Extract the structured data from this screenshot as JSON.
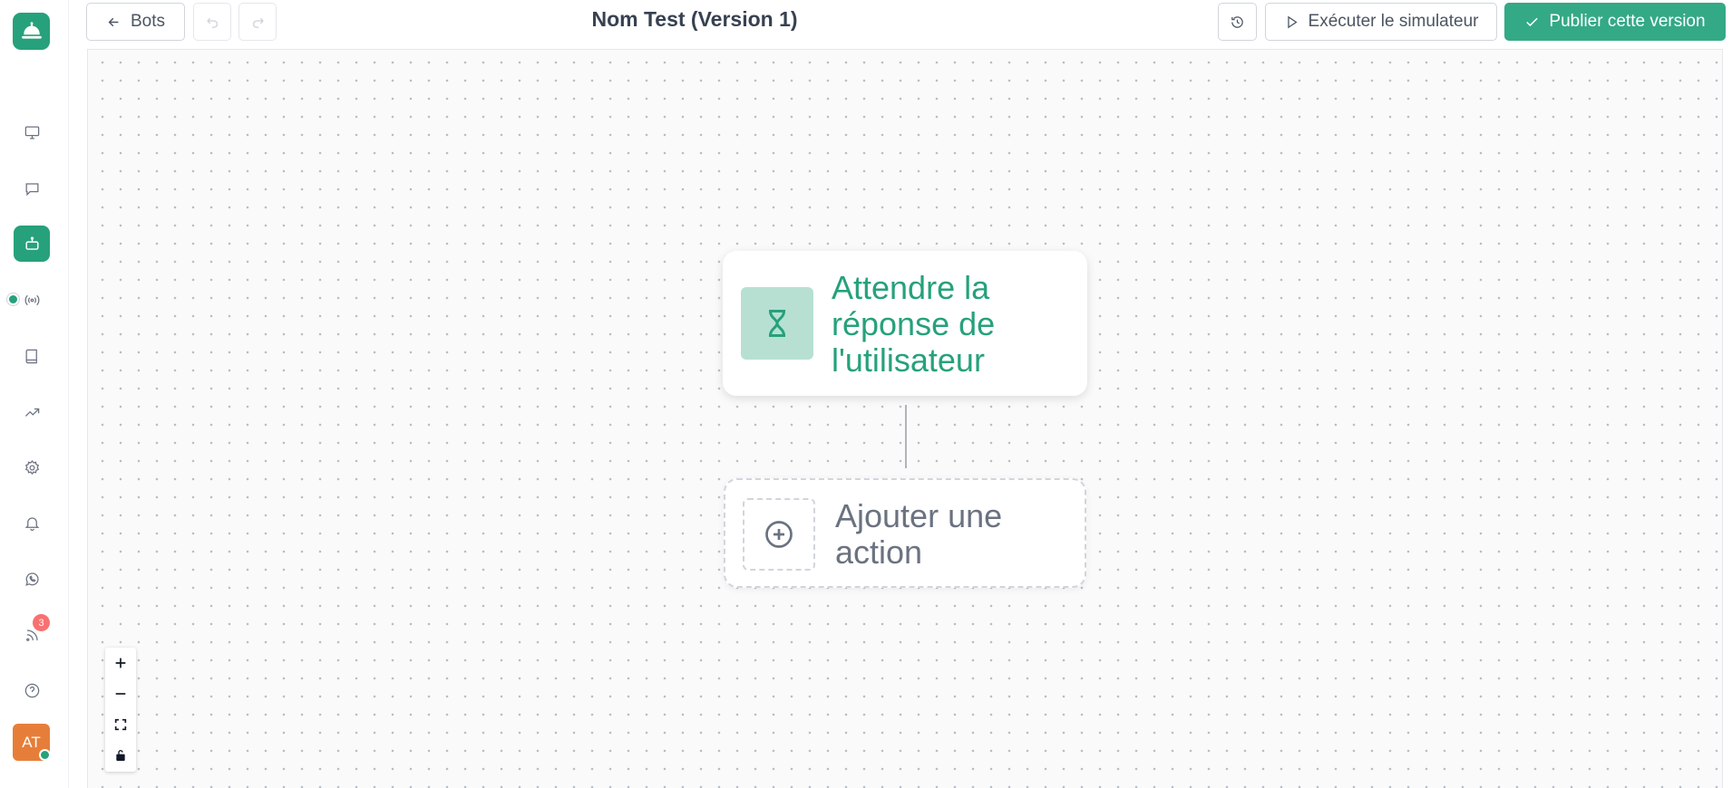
{
  "app": {
    "avatar_initials": "AT",
    "accent_color": "#26a17b",
    "primary_button_color": "#34a985"
  },
  "sidebar": {
    "logo": "bell-service-icon",
    "items": [
      {
        "icon": "monitor-icon",
        "active": false
      },
      {
        "icon": "chat-icon",
        "active": false
      },
      {
        "icon": "bot-icon",
        "active": true
      },
      {
        "icon": "broadcast-icon",
        "active": false
      },
      {
        "icon": "book-icon",
        "active": false
      },
      {
        "icon": "trend-icon",
        "active": false
      },
      {
        "icon": "gear-icon",
        "active": false
      },
      {
        "icon": "bell-icon",
        "active": false
      },
      {
        "icon": "whatsapp-icon",
        "active": false
      },
      {
        "icon": "rss-icon",
        "active": false,
        "badge": "3"
      },
      {
        "icon": "help-icon",
        "active": false
      }
    ]
  },
  "header": {
    "back_label": "Bots",
    "title": "Nom Test (Version 1)",
    "simulator_label": "Exécuter le simulateur",
    "publish_label": "Publier cette version"
  },
  "canvas": {
    "wait_node": {
      "label": "Attendre la réponse de l'utilisateur",
      "icon": "hourglass-icon"
    },
    "add_node": {
      "label": "Ajouter une action",
      "icon": "plus-circle-icon"
    }
  }
}
